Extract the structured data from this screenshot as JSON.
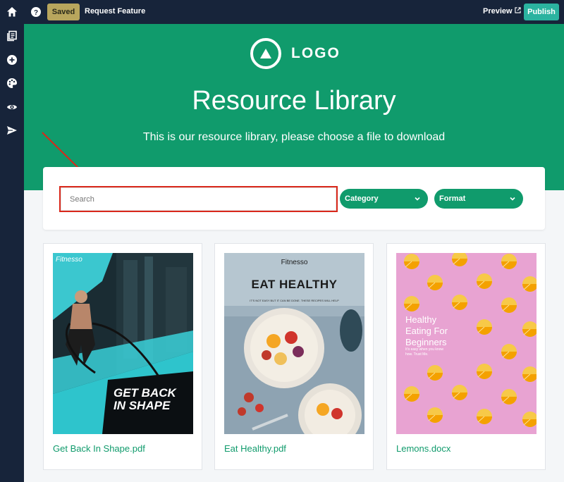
{
  "topbar": {
    "saved_label": "Saved",
    "request_label": "Request Feature",
    "preview_label": "Preview",
    "publish_label": "Publish"
  },
  "sidebar": {
    "icons": [
      "home-icon",
      "pages-icon",
      "add-icon",
      "palette-icon",
      "eye-icon",
      "send-icon"
    ]
  },
  "hero": {
    "logo_text": "LOGO",
    "title": "Resource Library",
    "subtitle": "This is our resource library, please choose a file to download"
  },
  "filters": {
    "search_placeholder": "Search",
    "category_label": "Category",
    "format_label": "Format"
  },
  "cards": [
    {
      "file_name": "Get Back In Shape.pdf",
      "thumb_brand": "Fitnesso",
      "thumb_text": "GET BACK IN SHAPE"
    },
    {
      "file_name": "Eat Healthy.pdf",
      "thumb_brand": "Fitnesso",
      "thumb_headline": "EAT HEALTHY",
      "thumb_tagline": "IT'S NOT EASY BUT IT CAN BE DONE. THESE RECIPES WILL HELP"
    },
    {
      "file_name": "Lemons.docx",
      "thumb_headline": "Healthy Eating For Beginners",
      "thumb_sub": "It's easy when you know how. Trust Me."
    }
  ],
  "colors": {
    "brand_green": "#109b6c",
    "nav_dark": "#17243a",
    "publish_teal": "#2bb3a0",
    "highlight_red": "#d9281b"
  }
}
